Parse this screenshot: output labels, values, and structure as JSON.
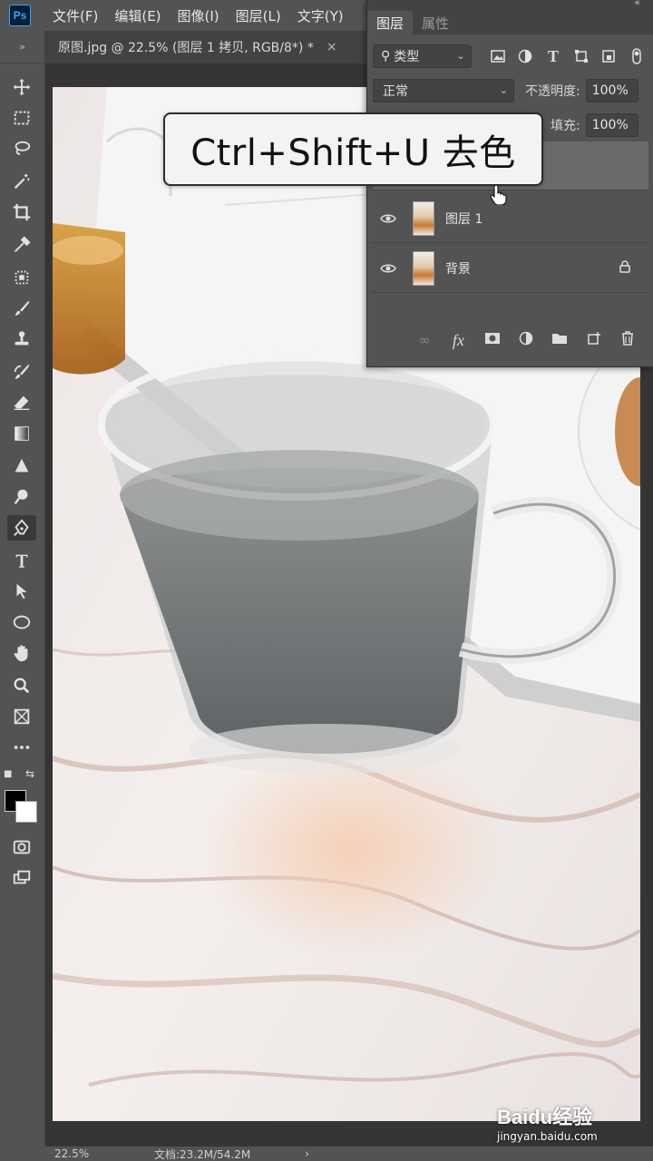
{
  "app": {
    "logo": "Ps"
  },
  "menu": [
    {
      "label": "文件(F)"
    },
    {
      "label": "编辑(E)"
    },
    {
      "label": "图像(I)"
    },
    {
      "label": "图层(L)"
    },
    {
      "label": "文字(Y)"
    }
  ],
  "document": {
    "tab_title": "原图.jpg @ 22.5% (图层 1 拷贝, RGB/8*) *",
    "close_glyph": "×"
  },
  "layers_panel": {
    "tabs": [
      {
        "label": "图层"
      },
      {
        "label": "属性"
      }
    ],
    "filter": {
      "label": "类型"
    },
    "blend_mode": "正常",
    "opacity": {
      "label": "不透明度:",
      "value": "100%"
    },
    "fill": {
      "label": "填充:",
      "value": "100%"
    },
    "layers": [
      {
        "name": "图层 1"
      },
      {
        "name": "背景"
      }
    ]
  },
  "caption": {
    "text": "Ctrl+Shift+U 去色"
  },
  "status": {
    "zoom": "22.5%",
    "doc_info": "文档:23.2M/54.2M",
    "arrow": "›"
  },
  "watermark": {
    "logo": "Baidu经验",
    "url": "jingyan.baidu.com"
  },
  "colors": {
    "foreground": "#000000",
    "background": "#ffffff",
    "accent": "#31a8ff"
  }
}
